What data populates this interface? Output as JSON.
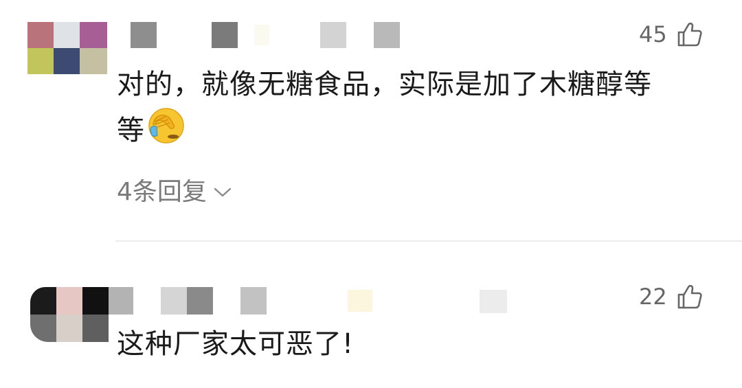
{
  "comments": [
    {
      "likes": "45",
      "text_line1": "对的，就像无糖食品，实际是加了木糖醇等",
      "text_line2": "等",
      "emoji": "facepalm-emoji",
      "replies_label": "4条回复"
    },
    {
      "likes": "22",
      "text": "这种厂家太可恶了!"
    }
  ],
  "colors": {
    "text": "#1a1a1a",
    "muted": "#7a7a7a",
    "likes": "#666666",
    "divider": "#ececec"
  }
}
